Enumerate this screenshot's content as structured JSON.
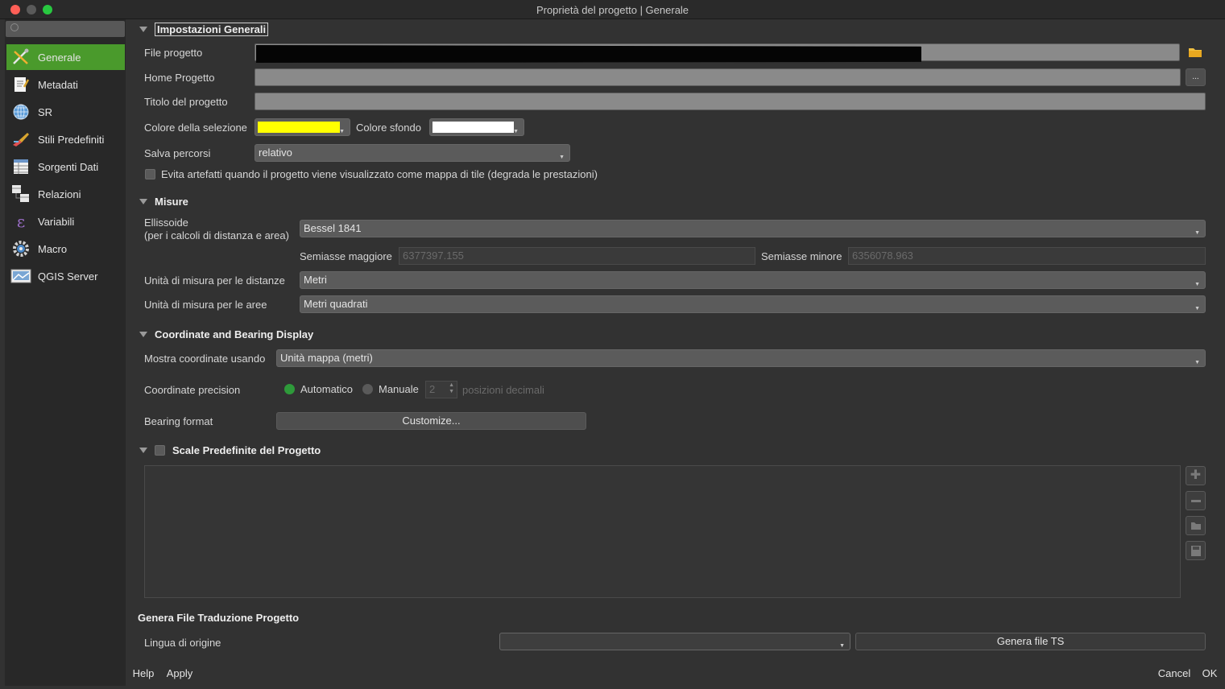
{
  "window": {
    "title": "Proprietà del progetto | Generale"
  },
  "sidebar": {
    "items": [
      {
        "label": "Generale",
        "icon": "generale-tools-icon",
        "active": true
      },
      {
        "label": "Metadati",
        "icon": "metadata-icon"
      },
      {
        "label": "SR",
        "icon": "globe-icon"
      },
      {
        "label": "Stili Predefiniti",
        "icon": "styles-brush-icon"
      },
      {
        "label": "Sorgenti Dati",
        "icon": "data-sources-icon"
      },
      {
        "label": "Relazioni",
        "icon": "relations-icon"
      },
      {
        "label": "Variabili",
        "icon": "variables-epsilon-icon"
      },
      {
        "label": "Macro",
        "icon": "macro-gear-icon"
      },
      {
        "label": "QGIS Server",
        "icon": "qgis-server-icon"
      }
    ]
  },
  "general": {
    "heading": "Impostazioni Generali",
    "file_label": "File progetto",
    "home_label": "Home Progetto",
    "home_browse": "...",
    "title_label": "Titolo del progetto",
    "title_value": "",
    "sel_color_label": "Colore della selezione",
    "sel_color": "#ffff00",
    "bg_color_label": "Colore sfondo",
    "bg_color": "#ffffff",
    "save_paths_label": "Salva percorsi",
    "save_paths_value": "relativo",
    "avoid_artifacts_label": "Evita artefatti quando il progetto viene visualizzato come mappa di tile (degrada le prestazioni)"
  },
  "measures": {
    "heading": "Misure",
    "ellipsoid_label_1": "Ellissoide",
    "ellipsoid_label_2": "(per i calcoli di distanza e area)",
    "ellipsoid_value": "Bessel 1841",
    "semi_major_label": "Semiasse maggiore",
    "semi_major_value": "6377397.155",
    "semi_minor_label": "Semiasse minore",
    "semi_minor_value": "6356078.963",
    "distance_units_label": "Unità di misura per le distanze",
    "distance_units_value": "Metri",
    "area_units_label": "Unità di misura per le aree",
    "area_units_value": "Metri quadrati"
  },
  "coords": {
    "heading": "Coordinate and Bearing Display",
    "show_label": "Mostra coordinate usando",
    "show_value": "Unità mappa (metri)",
    "precision_label": "Coordinate precision",
    "auto_label": "Automatico",
    "manual_label": "Manuale",
    "decimals_value": "2",
    "decimals_suffix": "posizioni decimali",
    "bearing_label": "Bearing format",
    "customize_label": "Customize..."
  },
  "scales": {
    "heading": "Scale Predefinite del Progetto"
  },
  "translation": {
    "heading": "Genera File Traduzione Progetto",
    "source_lang_label": "Lingua di origine",
    "source_lang_value": "",
    "generate_label": "Genera file TS"
  },
  "footer": {
    "help": "Help",
    "apply": "Apply",
    "cancel": "Cancel",
    "ok": "OK"
  }
}
